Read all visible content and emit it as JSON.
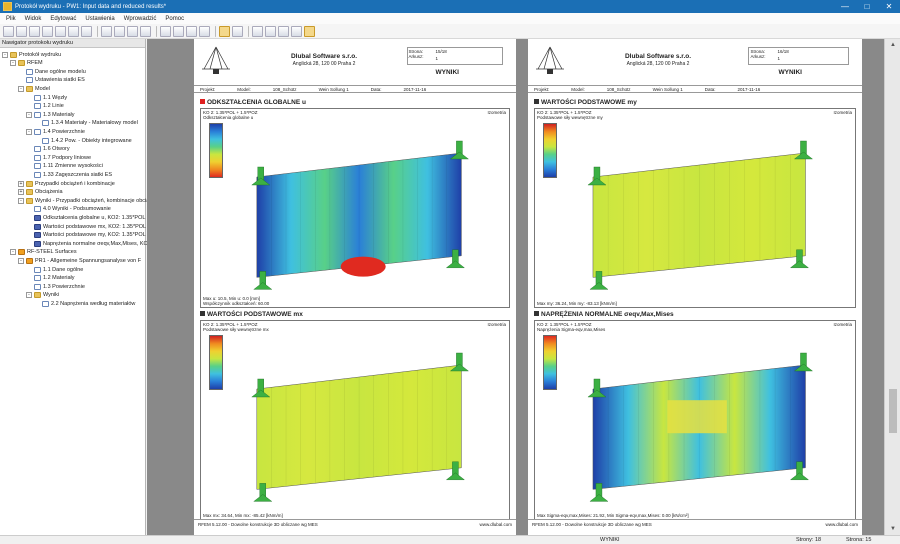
{
  "window": {
    "title": "Protokół wydruku - PW1: Input data and reduced results*",
    "minimize_glyph": "—",
    "maximize_glyph": "□",
    "close_glyph": "✕"
  },
  "menu": [
    "Plik",
    "Widok",
    "Edytować",
    "Ustawienia",
    "Wprowadzić",
    "Pomoc"
  ],
  "navigator": {
    "title": "Nawigator protokołu wydruku",
    "items": [
      {
        "label": "Protokół wydruku",
        "level": 0,
        "icon": "folder",
        "toggle": "-"
      },
      {
        "label": "RFEM",
        "level": 1,
        "icon": "folder",
        "toggle": "-"
      },
      {
        "label": "Dane ogólne modelu",
        "level": 2,
        "icon": "page",
        "toggle": ""
      },
      {
        "label": "Ustawienia siatki ES",
        "level": 2,
        "icon": "page",
        "toggle": ""
      },
      {
        "label": "Model",
        "level": 2,
        "icon": "folder",
        "toggle": "-"
      },
      {
        "label": "1.1 Węzły",
        "level": 3,
        "icon": "page",
        "toggle": ""
      },
      {
        "label": "1.2 Linie",
        "level": 3,
        "icon": "page",
        "toggle": ""
      },
      {
        "label": "1.3 Materiały",
        "level": 3,
        "icon": "page",
        "toggle": "-"
      },
      {
        "label": "1.3.4 Materiały - Materiałowy model",
        "level": 4,
        "icon": "page",
        "toggle": ""
      },
      {
        "label": "1.4 Powierzchnie",
        "level": 3,
        "icon": "page",
        "toggle": "-"
      },
      {
        "label": "1.4.2 Pow. - Obiekty integrowane",
        "level": 4,
        "icon": "page",
        "toggle": ""
      },
      {
        "label": "1.6 Otwory",
        "level": 3,
        "icon": "page",
        "toggle": ""
      },
      {
        "label": "1.7 Podpory liniowe",
        "level": 3,
        "icon": "page",
        "toggle": ""
      },
      {
        "label": "1.11 Zmienne wysokości",
        "level": 3,
        "icon": "page",
        "toggle": ""
      },
      {
        "label": "1.33 Zagęszczenia siatki ES",
        "level": 3,
        "icon": "page",
        "toggle": ""
      },
      {
        "label": "Przypadki obciążeń i kombinacje",
        "level": 2,
        "icon": "folder",
        "toggle": "+"
      },
      {
        "label": "Obciążenia",
        "level": 2,
        "icon": "folder",
        "toggle": "+"
      },
      {
        "label": "Wyniki - Przypadki obciążeń, kombinacje obciążeń",
        "level": 2,
        "icon": "folder",
        "toggle": "-"
      },
      {
        "label": "4.0 Wyniki - Podsumowanie",
        "level": 3,
        "icon": "page",
        "toggle": ""
      },
      {
        "label": "Odkształcenia globalne u, KO2: 1.35*POL",
        "level": 3,
        "icon": "cube",
        "toggle": ""
      },
      {
        "label": "Wartości podstawowe mx, KO2: 1.35*POL",
        "level": 3,
        "icon": "cube",
        "toggle": ""
      },
      {
        "label": "Wartości podstawowe my, KO2: 1.35*POL",
        "level": 3,
        "icon": "cube",
        "toggle": ""
      },
      {
        "label": "Naprężenia normalne σeqv,Max,Mises, KO2",
        "level": 3,
        "icon": "cube",
        "toggle": ""
      },
      {
        "label": "RF-STEEL Surfaces",
        "level": 1,
        "icon": "mesh",
        "toggle": "-"
      },
      {
        "label": "PR1 - Allgemeine Spannungsanalyse von F",
        "level": 2,
        "icon": "mesh",
        "toggle": "-"
      },
      {
        "label": "1.1 Dane ogólne",
        "level": 3,
        "icon": "page",
        "toggle": ""
      },
      {
        "label": "1.2 Materiały",
        "level": 3,
        "icon": "page",
        "toggle": ""
      },
      {
        "label": "1.3 Powierzchnie",
        "level": 3,
        "icon": "page",
        "toggle": ""
      },
      {
        "label": "Wyniki",
        "level": 3,
        "icon": "folder",
        "toggle": "-"
      },
      {
        "label": "2.2 Naprężenia według materiałów",
        "level": 4,
        "icon": "page",
        "toggle": ""
      }
    ]
  },
  "page_header": {
    "company": "Dlubal Software s.r.o.",
    "address": "Anglická 28, 120 00 Praha 2",
    "strona_label": "Strona:",
    "arkusz_label": "Arkusz:",
    "section_label": "WYNIKI",
    "projekt_label": "Projekt:",
    "model_label": "Model:",
    "model_value": "108_Schütz",
    "data_label": "Data:",
    "data_value": "2017-11-16",
    "wein_label": "Wein Sollung 1"
  },
  "pages": [
    {
      "strona": "15/18",
      "arkusz": "1",
      "panels": [
        {
          "title": "ODKSZTAŁCENIA GLOBALNE u",
          "marker": "red",
          "cap1": "KO 2: 1.35*POL + 1.5*POZ",
          "cap2": "Odkształcenia globalne u",
          "iso": "Izometria",
          "foot1": "Max u: 10.5, Min u: 0.0 [mm]",
          "foot2": "Współczynnik odkształceń: 60.00",
          "palette": "deform"
        },
        {
          "title": "WARTOŚCI PODSTAWOWE mx",
          "marker": "dark",
          "cap1": "KO 2: 1.35*POL + 1.5*POZ",
          "cap2": "Podstawowe siły wewnętrzne mx",
          "iso": "Izometria",
          "foot1": "Max mx: 34.64, Min mx: -85.42 [kNm/m]",
          "foot2": "",
          "palette": "moment"
        }
      ],
      "footer_left": "RFEM 5.12.00 - Dowolne konstrukcje 3D obliczane wg MES",
      "footer_right": "www.dlubal.com"
    },
    {
      "strona": "16/18",
      "arkusz": "1",
      "panels": [
        {
          "title": "WARTOŚCI PODSTAWOWE my",
          "marker": "dark",
          "cap1": "KO 2: 1.35*POL + 1.5*POZ",
          "cap2": "Podstawowe siły wewnętrzne my",
          "iso": "Izometria",
          "foot1": "Max my: 36.24, Min my: -83.13 [kNm/m]",
          "foot2": "",
          "palette": "moment"
        },
        {
          "title": "NAPRĘŻENIA NORMALNE σeqv,Max,Mises",
          "marker": "dark",
          "cap1": "KO 2: 1.35*POL + 1.5*POZ",
          "cap2": "Naprężenia Sigma-eqv,max,Mises",
          "iso": "Izometria",
          "foot1": "Max Sigma-eqv,max,Mises: 21.92, Min Sigma-eqv,max,Mises: 0.00 [kN/cm²]",
          "foot2": "",
          "palette": "stress"
        }
      ],
      "footer_left": "RFEM 5.12.00 - Dowolne konstrukcje 3D obliczane wg MES",
      "footer_right": "www.dlubal.com"
    }
  ],
  "status": {
    "center": "WYNIKI",
    "pages": "Strony: 18",
    "page": "Strona: 15"
  },
  "scroll": {
    "position_fraction": 0.79
  },
  "colors": {
    "titlebar": "#1b6fb5",
    "workspace": "#898989",
    "support": "#3cb043"
  }
}
